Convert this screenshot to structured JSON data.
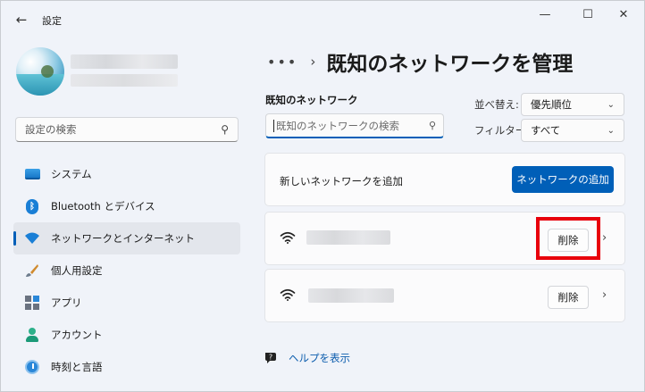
{
  "window": {
    "title": "設定",
    "back_icon": "arrow-left-icon",
    "controls": [
      "minimize-icon",
      "maximize-icon",
      "close-icon"
    ]
  },
  "sidebar": {
    "search_placeholder": "設定の検索",
    "items": [
      {
        "label": "システム",
        "icon": "monitor-icon",
        "active": false
      },
      {
        "label": "Bluetooth とデバイス",
        "icon": "bluetooth-icon",
        "active": false
      },
      {
        "label": "ネットワークとインターネット",
        "icon": "wifi-icon",
        "active": true
      },
      {
        "label": "個人用設定",
        "icon": "brush-icon",
        "active": false
      },
      {
        "label": "アプリ",
        "icon": "apps-icon",
        "active": false
      },
      {
        "label": "アカウント",
        "icon": "account-icon",
        "active": false
      },
      {
        "label": "時刻と言語",
        "icon": "clock-icon",
        "active": false
      }
    ]
  },
  "breadcrumb": {
    "more": "•••",
    "separator": "›",
    "title": "既知のネットワークを管理"
  },
  "known": {
    "label": "既知のネットワーク",
    "search_placeholder": "既知のネットワークの検索"
  },
  "sort": {
    "label": "並べ替え:",
    "value": "優先順位"
  },
  "filter": {
    "label": "フィルター:",
    "value": "すべて"
  },
  "add_network": {
    "label": "新しいネットワークを追加",
    "button": "ネットワークの追加"
  },
  "networks": [
    {
      "delete_label": "削除",
      "highlighted": true
    },
    {
      "delete_label": "削除",
      "highlighted": false
    }
  ],
  "help": {
    "label": "ヘルプを表示"
  },
  "colors": {
    "accent": "#005fb8",
    "highlight": "#e8000b"
  }
}
